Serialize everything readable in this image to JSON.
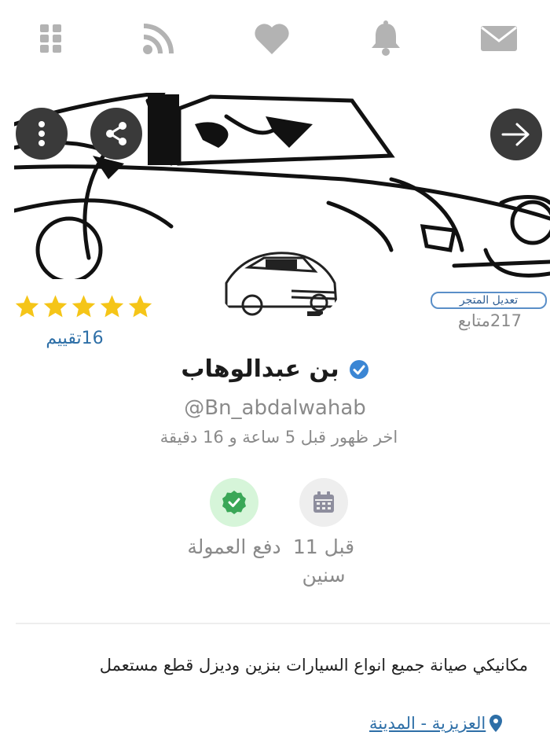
{
  "topbar": {
    "icons": [
      "envelope-icon",
      "bell-icon",
      "heart-icon",
      "rss-icon",
      "grid-menu-icon"
    ]
  },
  "store": {
    "edit_label": "تعديل المتجر",
    "followers": "217متابع",
    "rating_stars": 5,
    "rating_count": "16تقييم",
    "name": "بن عبدالوهاب",
    "handle": "@Bn_abdalwahab",
    "last_seen": "اخر ظهور قبل 5 ساعة و 16 دقيقة",
    "membership": "قبل 11 سنين",
    "commission": "دفع العمولة",
    "description": "مكانيكي صيانة جميع انواع السيارات بنزين وديزل قطع مستعمل",
    "location": "العزيزية - المدينة"
  },
  "colors": {
    "icon_gray": "#b3b3b3",
    "link_blue": "#2e6fa7",
    "star_yellow": "#f5c518",
    "verified_blue": "#3b86d4",
    "commission_green": "#3aa757"
  }
}
